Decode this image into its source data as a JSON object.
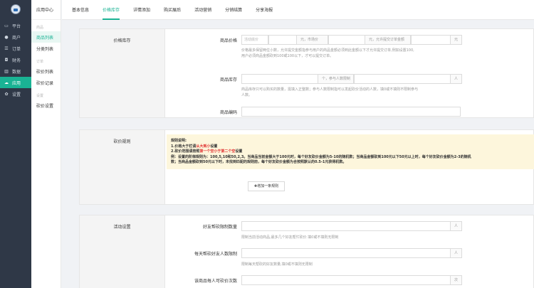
{
  "nav": {
    "items": [
      {
        "icon": "monitor-icon",
        "glyph": "▭",
        "label": "平台"
      },
      {
        "icon": "users-icon",
        "glyph": "●",
        "label": "商户"
      },
      {
        "icon": "list-icon",
        "glyph": "☰",
        "label": "订单"
      },
      {
        "icon": "finance-icon",
        "glyph": "◘",
        "label": "财务"
      },
      {
        "icon": "chart-icon",
        "glyph": "▥",
        "label": "数据"
      },
      {
        "icon": "app-icon",
        "glyph": "☁",
        "label": "应用"
      },
      {
        "icon": "gear-icon",
        "glyph": "✿",
        "label": "设置"
      }
    ]
  },
  "sub": {
    "title": "应用中心",
    "groups": [
      {
        "label": "商品",
        "items": [
          "商品列表",
          "分类列表"
        ]
      },
      {
        "label": "订单",
        "items": [
          "砍价列表",
          "砍价记录"
        ]
      },
      {
        "label": "设置",
        "items": [
          "砍价设置"
        ]
      }
    ]
  },
  "tabs": [
    "基本信息",
    "价格库存",
    "详情添加",
    "购买展后",
    "活动营销",
    "分销结算",
    "分享海报"
  ],
  "price_card": {
    "title": "价格库存",
    "price_label": "商品价格",
    "price_placeholder_1": "活动底价",
    "price_addon_1": "元，市场价",
    "price_addon_2": "元，允许提交订单金额",
    "price_addon_3": "元",
    "price_hint_1": "价格最多保留两位小数，允许提交金额指参与用户的商品金额必须到此金额以下才允许提交订单,例如设置100,",
    "price_hint_2": "用户必须商品金额砍到100或100以下，才可以提交订单。",
    "stock_label": "商品库存",
    "stock_addon_1": "个，参与人数限制",
    "stock_addon_2": "人",
    "stock_hint_1": "商品库存只可以购买的数量，需填入正整数；参与人数限制指可以发起砍价活动的人数，填0或不填则不限制参与",
    "stock_hint_2": "人数。",
    "code_label": "商品编码"
  },
  "rule_card": {
    "title": "砍价规则",
    "line1": "规则说明:",
    "line2_a": "1.价格大于栏请",
    "line2_b": "从大到小",
    "line2_c": "设置",
    "line3_a": "2.砍价范围请按照",
    "line3_b": "第一个空小于第二个空",
    "line3_c": "设置",
    "line4": "例：设置的阶梯规则为：100,5,10和50,2,3。当商品当前金额大于100元时，每个好友砍价金额为5-10的随机数；当商品金额砍到100元以下50元以上时，每个好友砍价金额为2-3的随机",
    "line5": "数；当商品金额砍到50元以下时，未找到匹配的规则前，每个好友砍价金额为合按照默认的0.5-1元获得机数。",
    "add_button": "✚增加一条规则"
  },
  "activity_card": {
    "title": "活动设置",
    "f1_label": "好友帮砍限制数量",
    "f1_addon": "人",
    "f1_hint": "限制当前活动商品,最多几个好友帮忙砍价 填0或不填则无限制",
    "f2_label": "每天帮砍好友人数限制",
    "f2_addon": "人",
    "f2_hint": "限制每天帮砍的好友数量,填0或不填则无限制",
    "f3_label": "该商品每人可砍价次数",
    "f3_addon": "次"
  }
}
